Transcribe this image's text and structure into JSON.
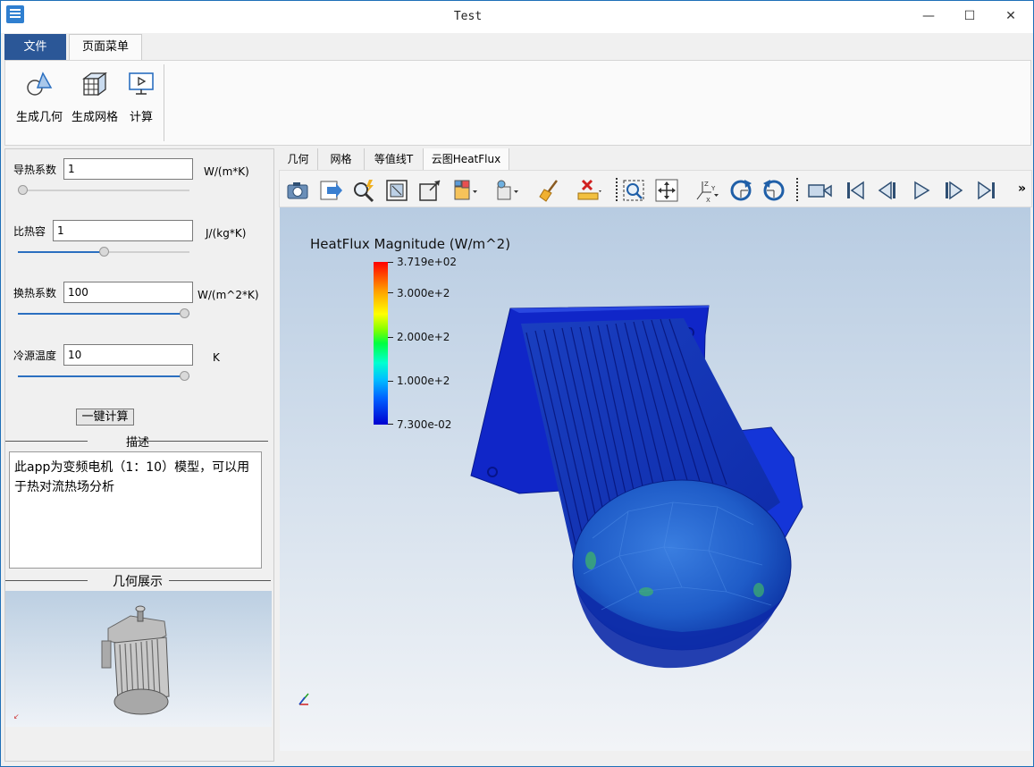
{
  "window": {
    "title": "Test",
    "minimize": "—",
    "maximize": "☐",
    "close": "✕"
  },
  "menu_tabs": {
    "file": "文件",
    "page_menu": "页面菜单"
  },
  "ribbon": {
    "gen_geometry": "生成几何",
    "gen_mesh": "生成网格",
    "compute": "计算"
  },
  "params": [
    {
      "label": "导热系数",
      "value": "1",
      "unit": "W/(m*K)",
      "slider_fraction": 0.0
    },
    {
      "label": "比热容",
      "value": "1",
      "unit": "J/(kg*K)",
      "slider_fraction": 0.5
    },
    {
      "label": "换热系数",
      "value": "100",
      "unit": "W/(m^2*K)",
      "slider_fraction": 1.0
    },
    {
      "label": "冷源温度",
      "value": "10",
      "unit": "K",
      "slider_fraction": 1.0
    }
  ],
  "calc_button": "一键计算",
  "description": {
    "title": "描述",
    "text": "此app为变频电机（1：10）模型，可以用于热对流热场分析"
  },
  "geometry_preview": {
    "title": "几何展示"
  },
  "view_tabs": [
    "几何",
    "网格",
    "等值线T",
    "云图HeatFlux"
  ],
  "colorbar": {
    "title": "HeatFlux Magnitude (W/m^2)",
    "labels": [
      "3.719e+02",
      "3.000e+2",
      "2.000e+2",
      "1.000e+2",
      "7.300e-02"
    ]
  },
  "toolbar_more": "»",
  "colors": {
    "accent": "#2b5797",
    "slider": "#2b6fc0"
  }
}
